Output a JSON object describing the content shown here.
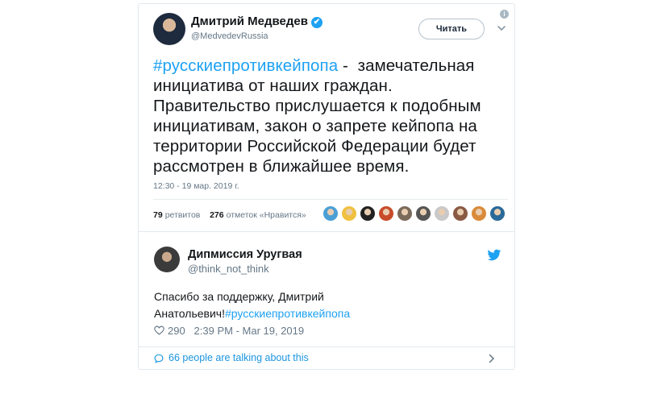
{
  "tweet": {
    "author_name": "Дмитрий Медведев",
    "author_handle": "@MedvedevRussia",
    "follow_label": "Читать",
    "info_glyph": "i",
    "verified_glyph": "✔",
    "hashtag": "#русскиепротивкейпопа",
    "text_rest": " -  замечательная инициатива от наших граждан. Правительство прислушается к подобным инициативам, закон о запрете кейпопа на территории Российской Федерации будет рассмотрен в ближайшее время.",
    "timestamp": "12:30 - 19 мар. 2019 г.",
    "retweets_count": "79",
    "retweets_label": "ретвитов",
    "likes_count": "276",
    "likes_label": "отметок «Нравится»",
    "liker_colors": [
      "#4a9fd5",
      "#f0c040",
      "#222222",
      "#c84c2a",
      "#7a6a5a",
      "#555555",
      "#c9c9c9",
      "#8a5a44",
      "#d98a3a",
      "#2a6a9a"
    ]
  },
  "reply": {
    "author_name": "Дипмиссия Уругвая",
    "author_handle": "@think_not_think",
    "text": "Спасибо за поддержку, Дмитрий Анатольевич!",
    "hashtag": "#русскиепротивкейпопа",
    "likes": "290",
    "time": "2:39 PM - Mar 19, 2019"
  },
  "footer": {
    "talking": "66 people are talking about this"
  },
  "colors": {
    "accent": "#1da1f2",
    "link": "#1b95e0",
    "muted": "#657786",
    "border": "#e1e8ed"
  },
  "icons": [
    "verified-icon",
    "info-icon",
    "chevron-down-icon",
    "twitter-bird-icon",
    "heart-icon",
    "speech-bubble-icon",
    "chevron-right-icon"
  ]
}
